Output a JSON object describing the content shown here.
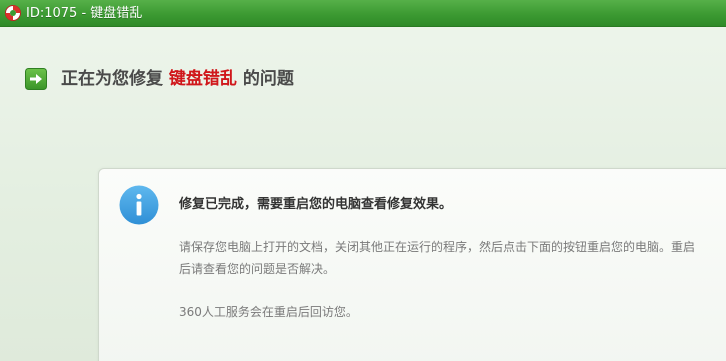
{
  "window": {
    "title": "ID:1075 - 键盘错乱",
    "icon": "lifebuoy-icon",
    "accent_color": "#3c9a32"
  },
  "headline": {
    "prefix": "正在为您修复",
    "problem": "键盘错乱",
    "suffix": "的问题",
    "problem_color": "#d0171b",
    "icon": "green-arrow-icon"
  },
  "card": {
    "icon": "info-icon",
    "title": "修复已完成，需要重启您的电脑查看修复效果。",
    "body": "请保存您电脑上打开的文档，关闭其他正在运行的程序，然后点击下面的按钮重启您的电脑。重启后请查看您的问题是否解决。",
    "footer": "360人工服务会在重启后回访您。"
  }
}
